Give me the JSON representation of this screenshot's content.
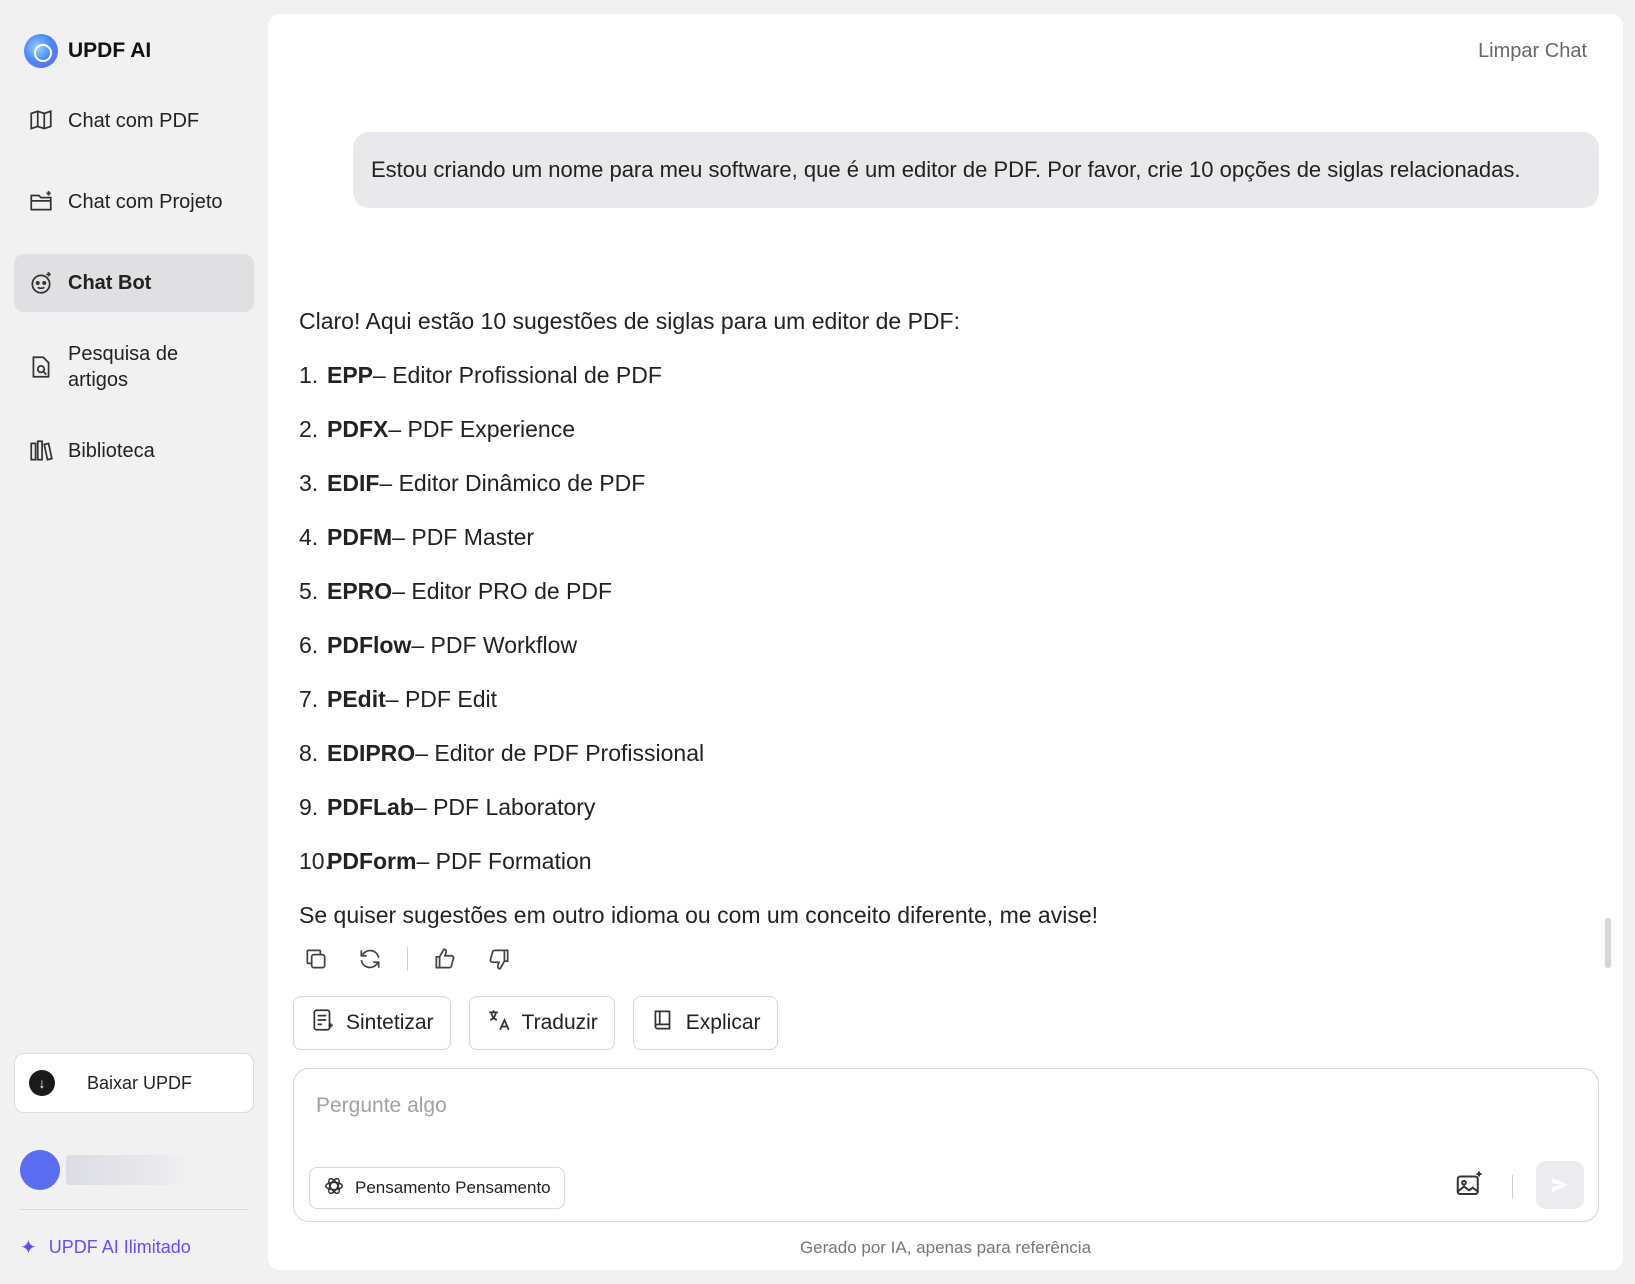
{
  "brand": {
    "name": "UPDF AI"
  },
  "sidebar": {
    "items": [
      {
        "label": "Chat com PDF",
        "icon": "book-open-icon",
        "active": false
      },
      {
        "label": "Chat com Projeto",
        "icon": "folder-sparkle-icon",
        "active": false
      },
      {
        "label": "Chat Bot",
        "icon": "bot-face-icon",
        "active": true
      },
      {
        "label": "Pesquisa de artigos",
        "icon": "document-search-icon",
        "active": false
      },
      {
        "label": "Biblioteca",
        "icon": "library-icon",
        "active": false
      }
    ],
    "download_label": "Baixar UPDF",
    "unlimited_label": "UPDF AI Ilimitado"
  },
  "header": {
    "clear_label": "Limpar Chat"
  },
  "conversation": {
    "user_message": "Estou criando um nome para meu software, que é um editor de PDF. Por favor, crie 10 opções de siglas relacionadas.",
    "answer_intro": "Claro! Aqui estão 10 sugestões de siglas para um editor de PDF:",
    "answer_items": [
      {
        "num": "1.",
        "code": "EPP",
        "desc": " – Editor Profissional de PDF"
      },
      {
        "num": "2.",
        "code": "PDFX",
        "desc": " – PDF Experience"
      },
      {
        "num": "3.",
        "code": "EDIF",
        "desc": " – Editor Dinâmico de PDF"
      },
      {
        "num": "4.",
        "code": "PDFM",
        "desc": " – PDF Master"
      },
      {
        "num": "5.",
        "code": "EPRO",
        "desc": " – Editor PRO de PDF"
      },
      {
        "num": "6.",
        "code": "PDFlow",
        "desc": " – PDF Workflow"
      },
      {
        "num": "7.",
        "code": "PEdit",
        "desc": " – PDF Edit"
      },
      {
        "num": "8.",
        "code": "EDIPRO",
        "desc": " – Editor de PDF Profissional"
      },
      {
        "num": "9.",
        "code": "PDFLab",
        "desc": " – PDF Laboratory"
      },
      {
        "num": "10.",
        "code": "PDForm",
        "desc": " – PDF Formation"
      }
    ],
    "answer_outro": "Se quiser sugestões em outro idioma ou com um conceito diferente, me avise!"
  },
  "quick_actions": [
    {
      "label": "Sintetizar",
      "icon": "summarize-icon"
    },
    {
      "label": "Traduzir",
      "icon": "translate-icon"
    },
    {
      "label": "Explicar",
      "icon": "book-icon"
    }
  ],
  "composer": {
    "placeholder": "Pergunte algo",
    "value": "",
    "thinking_label": "Pensamento Pensamento"
  },
  "footer": {
    "disclaimer": "Gerado por IA, apenas para referência"
  },
  "colors": {
    "accent": "#6a4bff",
    "active_nav": "#e0e0e2",
    "bubble": "#e9e9eb"
  }
}
